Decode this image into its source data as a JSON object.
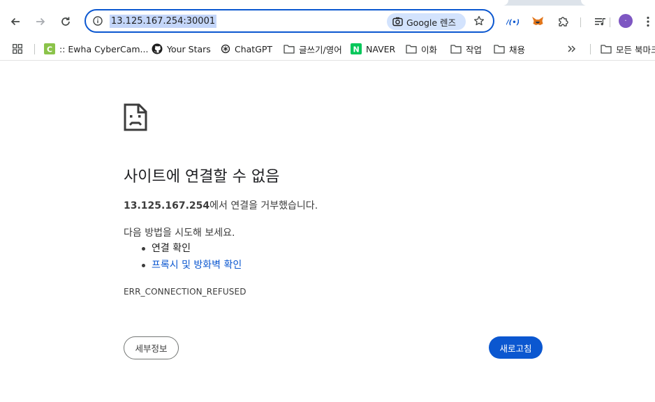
{
  "toolbar": {
    "url": "13.125.167.254:30001",
    "lens_label": "Google 렌즈",
    "avatar_initial": "·"
  },
  "bookmarks": [
    {
      "label": ":: Ewha CyberCam...",
      "icon": "ewha-favicon"
    },
    {
      "label": "Your Stars",
      "icon": "github-icon"
    },
    {
      "label": "ChatGPT",
      "icon": "chatgpt-icon"
    },
    {
      "label": "글쓰기/영어",
      "icon": "folder-icon"
    },
    {
      "label": "NAVER",
      "icon": "naver-favicon"
    },
    {
      "label": "이화",
      "icon": "folder-icon"
    },
    {
      "label": "작업",
      "icon": "folder-icon"
    },
    {
      "label": "채용",
      "icon": "folder-icon"
    },
    {
      "label": "모든 북마크",
      "icon": "folder-icon"
    }
  ],
  "error": {
    "title": "사이트에 연결할 수 없음",
    "host": "13.125.167.254",
    "message_suffix": "에서 연결을 거부했습니다.",
    "try_label": "다음 방법을 시도해 보세요.",
    "suggestions": [
      "연결 확인",
      "프록시 및 방화벽 확인"
    ],
    "code": "ERR_CONNECTION_REFUSED",
    "details_button": "세부정보",
    "reload_button": "새로고침"
  },
  "colors": {
    "accent": "#0b57d0",
    "lens_bg": "#d3e3fd",
    "url_highlight": "#c4d6f9",
    "avatar": "#7e57c2"
  }
}
